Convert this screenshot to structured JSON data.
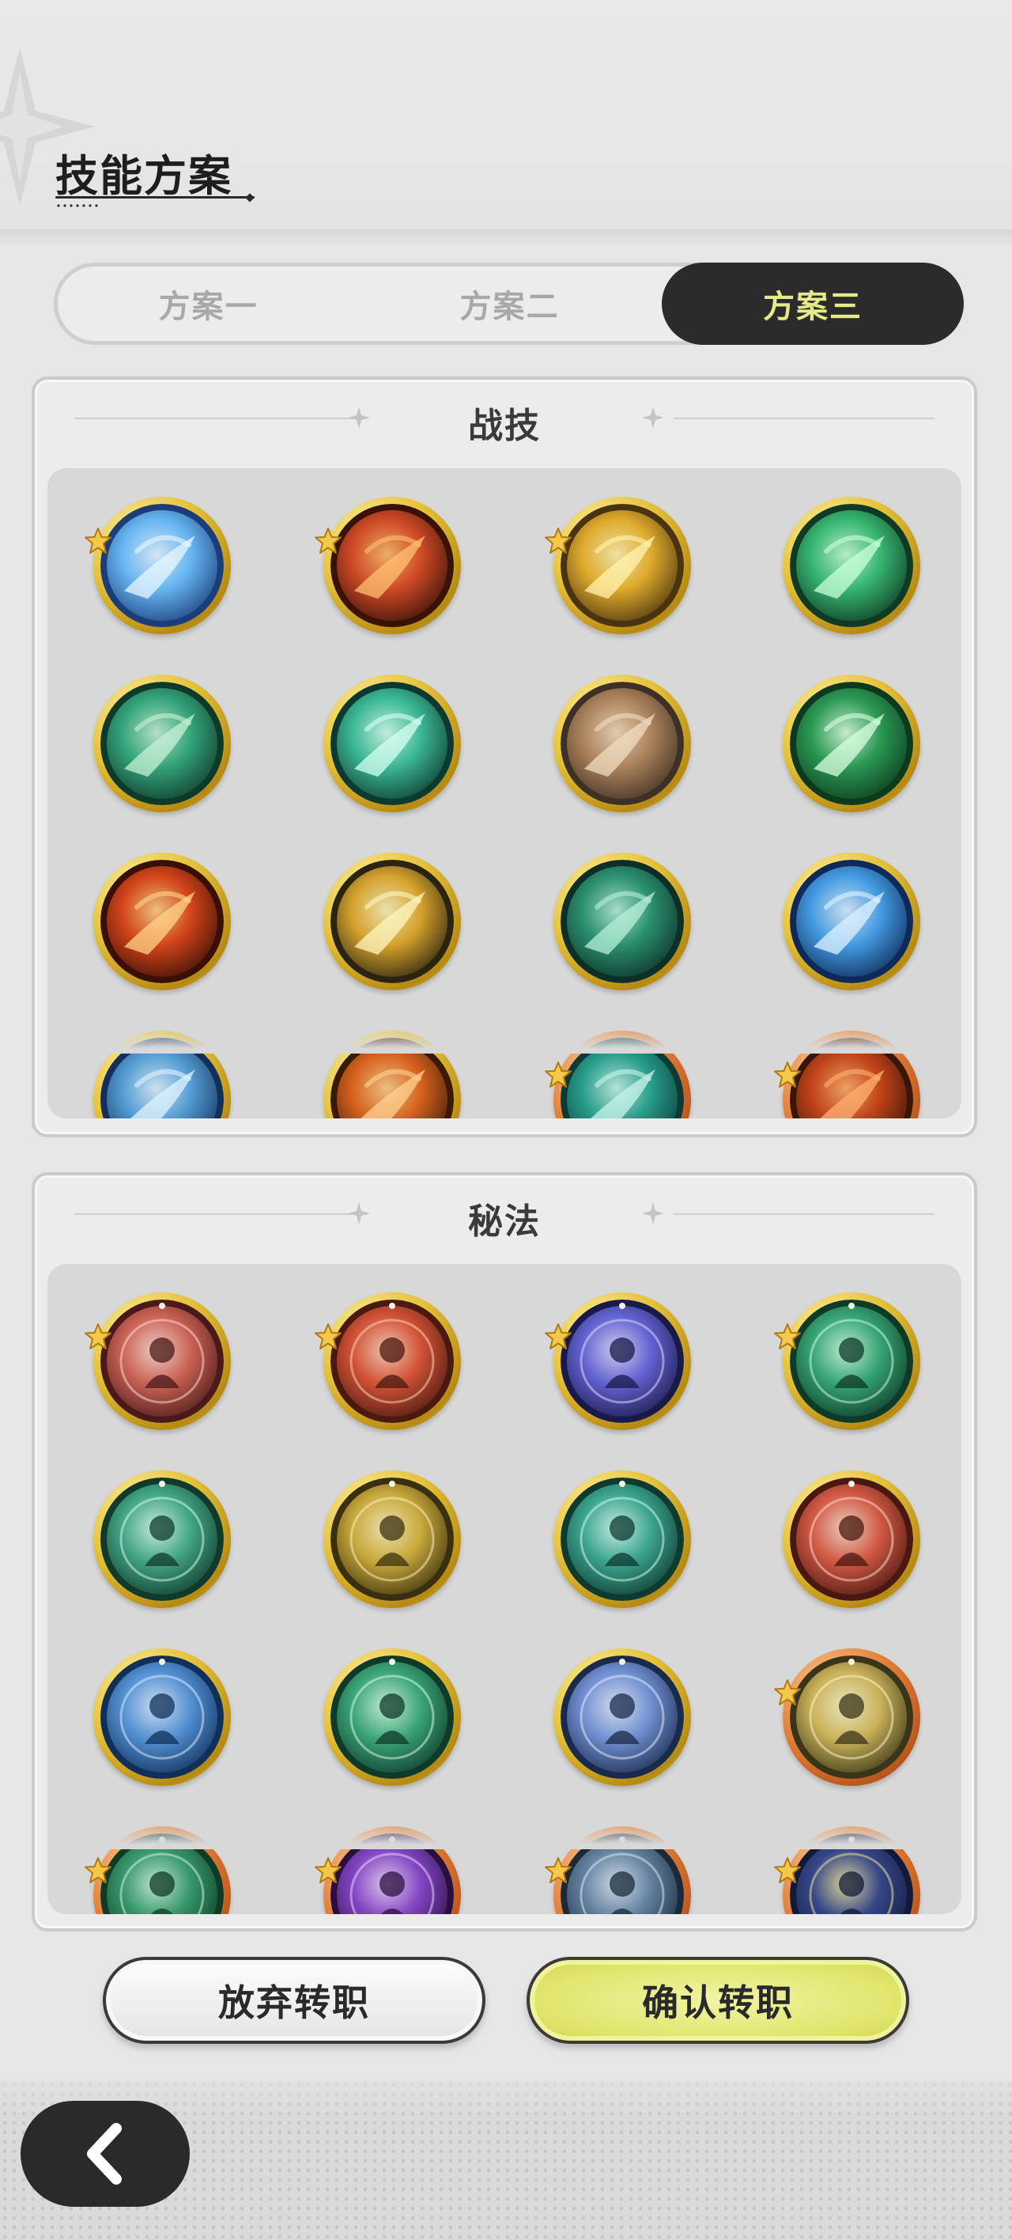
{
  "header": {
    "title": "技能方案"
  },
  "plans": {
    "tabs": [
      {
        "label": "方案一",
        "selected": false
      },
      {
        "label": "方案二",
        "selected": false
      },
      {
        "label": "方案三",
        "selected": true
      }
    ]
  },
  "combat_skills": {
    "title": "战技",
    "icons": [
      {
        "name": "ice-burst-skill-icon",
        "starred": true,
        "ring": "gold"
      },
      {
        "name": "fire-vortex-skill-icon",
        "starred": true,
        "ring": "gold"
      },
      {
        "name": "golden-strike-skill-icon",
        "starred": true,
        "ring": "gold"
      },
      {
        "name": "green-slash-skill-icon",
        "starred": false,
        "ring": "gold"
      },
      {
        "name": "wind-orb-skill-icon",
        "starred": false,
        "ring": "gold"
      },
      {
        "name": "wind-blades-skill-icon",
        "starred": false,
        "ring": "gold"
      },
      {
        "name": "rock-shield-skill-icon",
        "starred": false,
        "ring": "gold"
      },
      {
        "name": "healing-cross-skill-icon",
        "starred": false,
        "ring": "gold"
      },
      {
        "name": "fireball-skill-icon",
        "starred": false,
        "ring": "gold"
      },
      {
        "name": "lightning-bolt-skill-icon",
        "starred": false,
        "ring": "gold"
      },
      {
        "name": "thorn-vine-skill-icon",
        "starred": false,
        "ring": "gold"
      },
      {
        "name": "ice-crystal-skill-icon",
        "starred": false,
        "ring": "gold"
      },
      {
        "name": "ice-spike-skill-icon",
        "starred": false,
        "ring": "gold"
      },
      {
        "name": "flame-wave-skill-icon",
        "starred": false,
        "ring": "gold"
      },
      {
        "name": "tide-swirl-skill-icon",
        "starred": true,
        "ring": "orange"
      },
      {
        "name": "meteor-skill-icon",
        "starred": true,
        "ring": "orange"
      }
    ]
  },
  "secret_arts": {
    "title": "秘法",
    "icons": [
      {
        "name": "crimson-orb-art-icon",
        "starred": true,
        "ring": "gold"
      },
      {
        "name": "phoenix-flame-art-icon",
        "starred": true,
        "ring": "gold"
      },
      {
        "name": "arcane-clock-art-icon",
        "starred": true,
        "ring": "gold"
      },
      {
        "name": "heart-art-icon",
        "starred": true,
        "ring": "gold"
      },
      {
        "name": "guard-shield-art-icon",
        "starred": false,
        "ring": "gold"
      },
      {
        "name": "power-up-art-icon",
        "starred": false,
        "ring": "gold"
      },
      {
        "name": "recycle-art-icon",
        "starred": false,
        "ring": "gold"
      },
      {
        "name": "fire-spirit-art-icon",
        "starred": false,
        "ring": "gold"
      },
      {
        "name": "water-spirit-art-icon",
        "starred": false,
        "ring": "gold"
      },
      {
        "name": "wind-spirit-art-icon",
        "starred": false,
        "ring": "gold"
      },
      {
        "name": "starlight-art-icon",
        "starred": false,
        "ring": "gold"
      },
      {
        "name": "golden-spirit-art-icon",
        "starred": true,
        "ring": "orange"
      },
      {
        "name": "jade-orb-art-icon",
        "starred": true,
        "ring": "orange"
      },
      {
        "name": "violet-vortex-art-icon",
        "starred": true,
        "ring": "orange"
      },
      {
        "name": "armor-art-icon",
        "starred": true,
        "ring": "orange"
      },
      {
        "name": "night-sky-art-icon",
        "starred": true,
        "ring": "orange"
      }
    ]
  },
  "actions": {
    "abandon_label": "放弃转职",
    "confirm_label": "确认转职"
  },
  "navigation": {
    "back_icon": "chevron-left-icon"
  },
  "colors": {
    "selected_tab_bg": "#2b2b2b",
    "selected_tab_text": "#e5ea8a",
    "confirm_button": "#dfe56a",
    "gold_ring": "#e6c23a",
    "orange_ring": "#e07a33"
  }
}
